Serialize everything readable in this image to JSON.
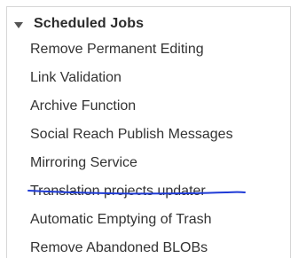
{
  "section": {
    "title": "Scheduled Jobs",
    "toggle_icon": "triangle-down-icon"
  },
  "jobs": [
    {
      "label": "Remove Permanent Editing"
    },
    {
      "label": "Link Validation"
    },
    {
      "label": "Archive Function"
    },
    {
      "label": "Social Reach Publish Messages"
    },
    {
      "label": "Mirroring Service"
    },
    {
      "label": "Translation projects updater"
    },
    {
      "label": "Automatic Emptying of Trash"
    },
    {
      "label": "Remove Abandoned BLOBs"
    }
  ],
  "annotation": {
    "highlighted_item": "Translation projects updater",
    "color": "#1f3bd6"
  }
}
